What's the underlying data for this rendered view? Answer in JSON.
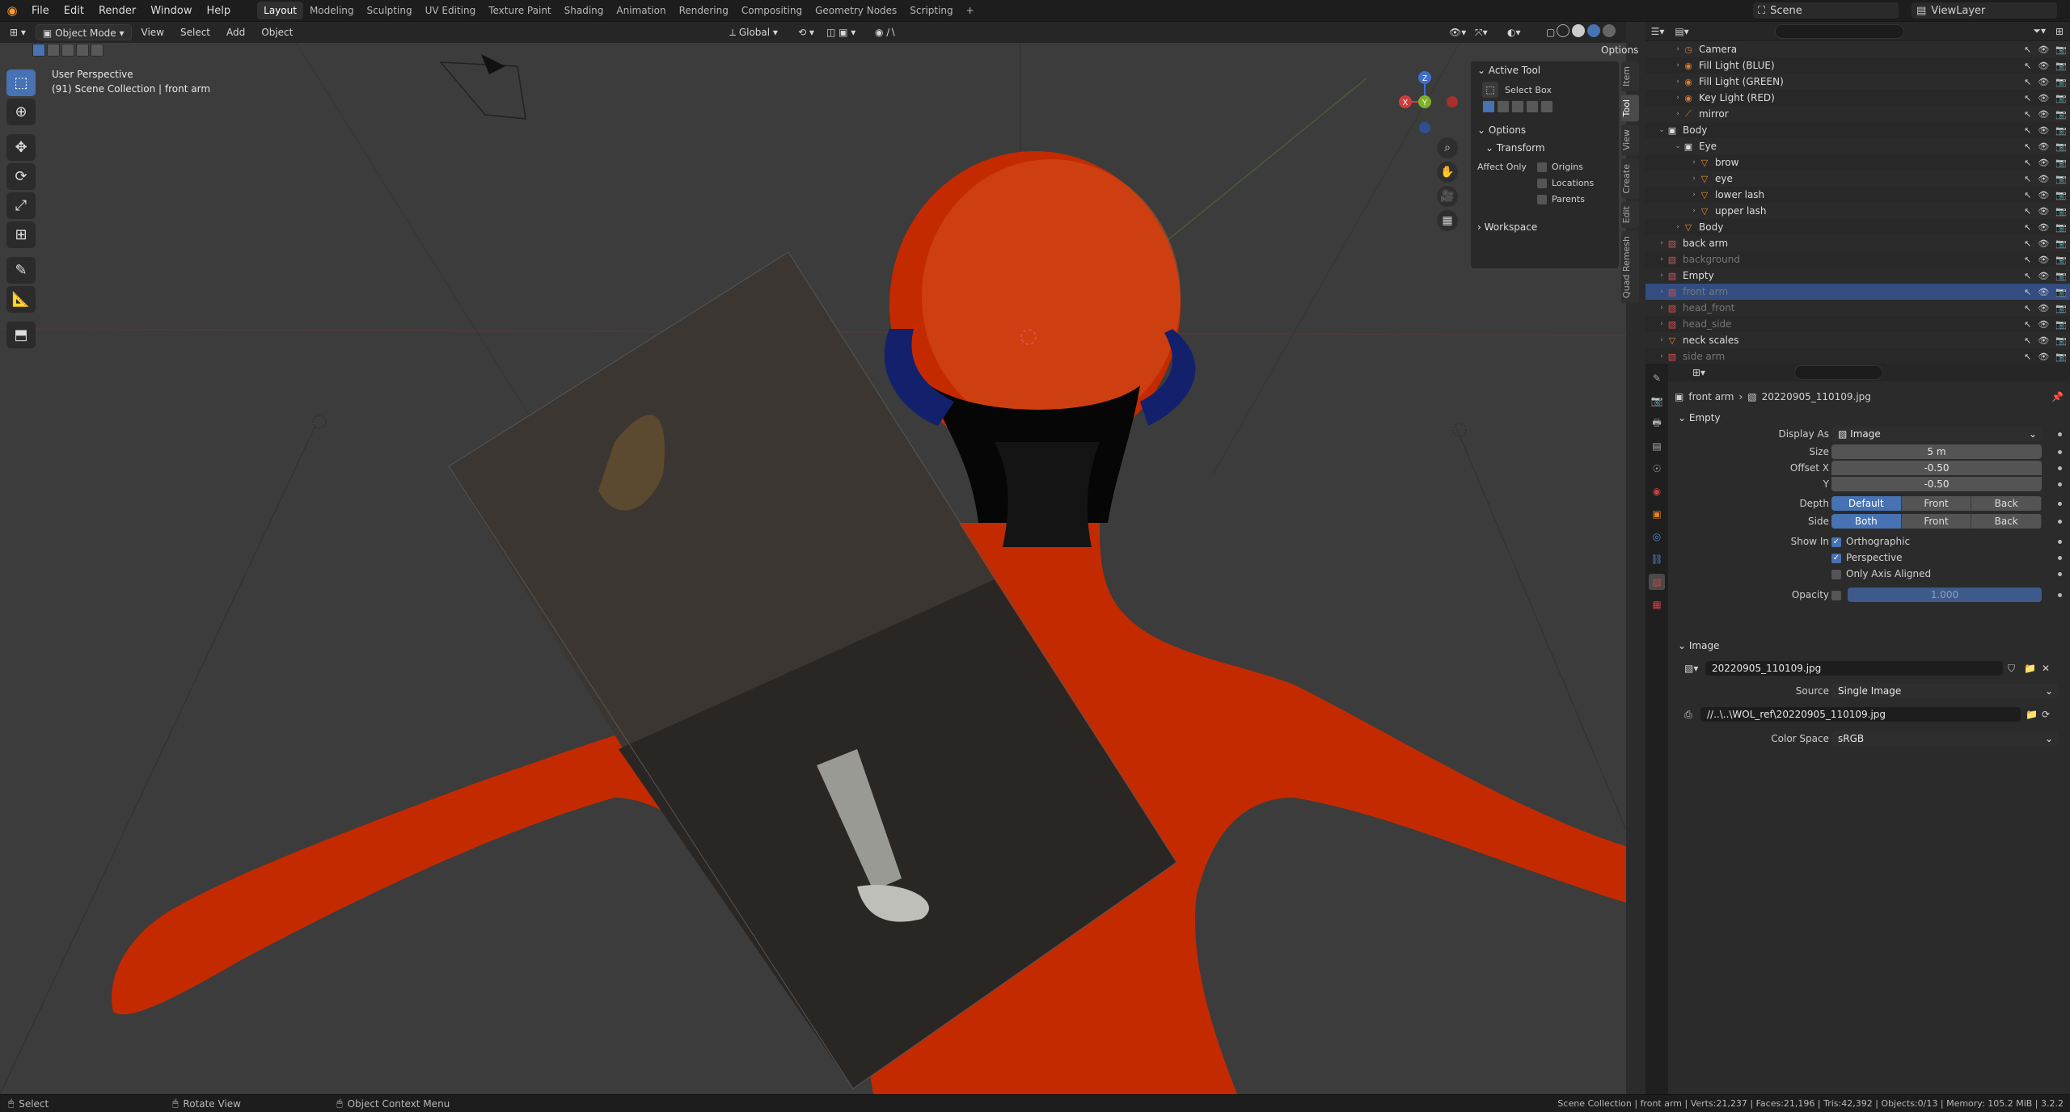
{
  "topbar": {
    "menus": [
      "File",
      "Edit",
      "Render",
      "Window",
      "Help"
    ],
    "workspaces": [
      "Layout",
      "Modeling",
      "Sculpting",
      "UV Editing",
      "Texture Paint",
      "Shading",
      "Animation",
      "Rendering",
      "Compositing",
      "Geometry Nodes",
      "Scripting"
    ],
    "active_workspace": "Layout",
    "add_tab": "+",
    "scene_label": "Scene",
    "viewlayer_label": "ViewLayer"
  },
  "viewport": {
    "mode": "Object Mode",
    "menus": [
      "View",
      "Select",
      "Add",
      "Object"
    ],
    "transform_orientation": "Global",
    "options_label": "Options",
    "overlay_line1": "User Perspective",
    "overlay_line2": "(91) Scene Collection | front arm",
    "axis_x": "X",
    "axis_y": "Y",
    "axis_z": "Z"
  },
  "npanel": {
    "active_tool_header": "Active Tool",
    "select_box_label": "Select Box",
    "options_header": "Options",
    "transform_header": "Transform",
    "affect_only_label": "Affect Only",
    "origins": "Origins",
    "locations": "Locations",
    "parents": "Parents",
    "workspace_header": "Workspace",
    "tabs": [
      "Item",
      "Tool",
      "View",
      "Create",
      "Edit",
      "Quad Remesh"
    ],
    "active_tab": "Tool"
  },
  "outliner": {
    "rows": [
      {
        "name": "Camera",
        "indent": 1,
        "type": "camera",
        "dim": false,
        "sel": false
      },
      {
        "name": "Fill Light (BLUE)",
        "indent": 1,
        "type": "light",
        "dim": false,
        "sel": false
      },
      {
        "name": "Fill Light (GREEN)",
        "indent": 1,
        "type": "light",
        "dim": false,
        "sel": false
      },
      {
        "name": "Key Light (RED)",
        "indent": 1,
        "type": "light",
        "dim": false,
        "sel": false
      },
      {
        "name": "mirror",
        "indent": 1,
        "type": "mod",
        "dim": false,
        "sel": false
      },
      {
        "name": "Body",
        "indent": 0,
        "type": "collection",
        "dim": false,
        "sel": false
      },
      {
        "name": "Eye",
        "indent": 1,
        "type": "collection",
        "dim": false,
        "sel": false
      },
      {
        "name": "brow",
        "indent": 2,
        "type": "mesh",
        "dim": false,
        "sel": false
      },
      {
        "name": "eye",
        "indent": 2,
        "type": "mesh",
        "dim": false,
        "sel": false
      },
      {
        "name": "lower lash",
        "indent": 2,
        "type": "mesh",
        "dim": false,
        "sel": false
      },
      {
        "name": "upper lash",
        "indent": 2,
        "type": "mesh",
        "dim": false,
        "sel": false
      },
      {
        "name": "Body",
        "indent": 1,
        "type": "mesh",
        "dim": false,
        "sel": false
      },
      {
        "name": "back arm",
        "indent": 0,
        "type": "image",
        "dim": false,
        "sel": false
      },
      {
        "name": "background",
        "indent": 0,
        "type": "image",
        "dim": true,
        "sel": false
      },
      {
        "name": "Empty",
        "indent": 0,
        "type": "image",
        "dim": false,
        "sel": false
      },
      {
        "name": "front arm",
        "indent": 0,
        "type": "image",
        "dim": true,
        "sel": true
      },
      {
        "name": "head_front",
        "indent": 0,
        "type": "image",
        "dim": true,
        "sel": false
      },
      {
        "name": "head_side",
        "indent": 0,
        "type": "image",
        "dim": true,
        "sel": false
      },
      {
        "name": "neck scales",
        "indent": 0,
        "type": "mesh",
        "dim": false,
        "sel": false
      },
      {
        "name": "side arm",
        "indent": 0,
        "type": "image",
        "dim": true,
        "sel": false
      }
    ]
  },
  "properties": {
    "breadcrumb_object": "front arm",
    "breadcrumb_data": "20220905_110109.jpg",
    "empty_header": "Empty",
    "display_as_label": "Display As",
    "display_as_value": "Image",
    "size_label": "Size",
    "size_value": "5 m",
    "offset_x_label": "Offset X",
    "offset_x_value": "-0.50",
    "offset_y_label": "Y",
    "offset_y_value": "-0.50",
    "depth_label": "Depth",
    "depth_options": [
      "Default",
      "Front",
      "Back"
    ],
    "depth_active": "Default",
    "side_label": "Side",
    "side_options": [
      "Both",
      "Front",
      "Back"
    ],
    "side_active": "Both",
    "show_in_label": "Show In",
    "orthographic": "Orthographic",
    "perspective": "Perspective",
    "only_axis_aligned": "Only Axis Aligned",
    "opacity_label": "Opacity",
    "opacity_value": "1.000",
    "image_header": "Image",
    "image_name": "20220905_110109.jpg",
    "source_label": "Source",
    "source_value": "Single Image",
    "filepath": "//..\\..\\WOL_ref\\20220905_110109.jpg",
    "color_space_label": "Color Space",
    "color_space_value": "sRGB"
  },
  "statusbar": {
    "select": "Select",
    "rotate": "Rotate View",
    "context": "Object Context Menu",
    "stats": "Scene Collection | front arm | Verts:21,237 | Faces:21,196 | Tris:42,392 | Objects:0/13 | Memory: 105.2 MiB | 3.2.2"
  },
  "colors": {
    "accent": "#4772b3",
    "body_red": "#c42a00",
    "viewport_bg": "#3c3c3c",
    "panel_bg": "#2b2b2b"
  }
}
